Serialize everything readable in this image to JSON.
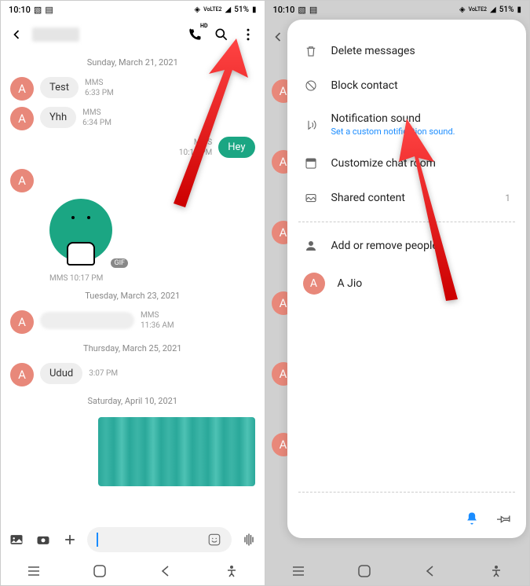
{
  "status": {
    "time": "10:10",
    "battery": "51%",
    "signal_label": "VoLTE2"
  },
  "left": {
    "dates": {
      "d1": "Sunday, March 21, 2021",
      "d2": "Tuesday, March 23, 2021",
      "d3": "Thursday, March 25, 2021",
      "d4": "Saturday, April 10, 2021"
    },
    "messages": [
      {
        "text": "Test",
        "type": "MMS",
        "time": "6:33 PM"
      },
      {
        "text": "Yhh",
        "type": "MMS",
        "time": "6:34 PM"
      },
      {
        "text": "Hey",
        "type": "MMS",
        "time": "10:17 PM",
        "sent": true
      },
      {
        "gif_meta": "MMS 10:17 PM",
        "gif_badge": "GIF"
      },
      {
        "type": "MMS",
        "time": "11:36 AM"
      },
      {
        "text": "Udud",
        "time": "3:07 PM"
      }
    ],
    "avatar_letter": "A"
  },
  "right": {
    "menu": {
      "delete": "Delete messages",
      "block": "Block contact",
      "notif": "Notification sound",
      "notif_sub": "Set a custom notification sound.",
      "customize": "Customize chat room",
      "shared": "Shared content",
      "shared_count": "1",
      "add_people": "Add or remove people",
      "contact": "A Jio"
    },
    "avatar_letter": "A"
  }
}
